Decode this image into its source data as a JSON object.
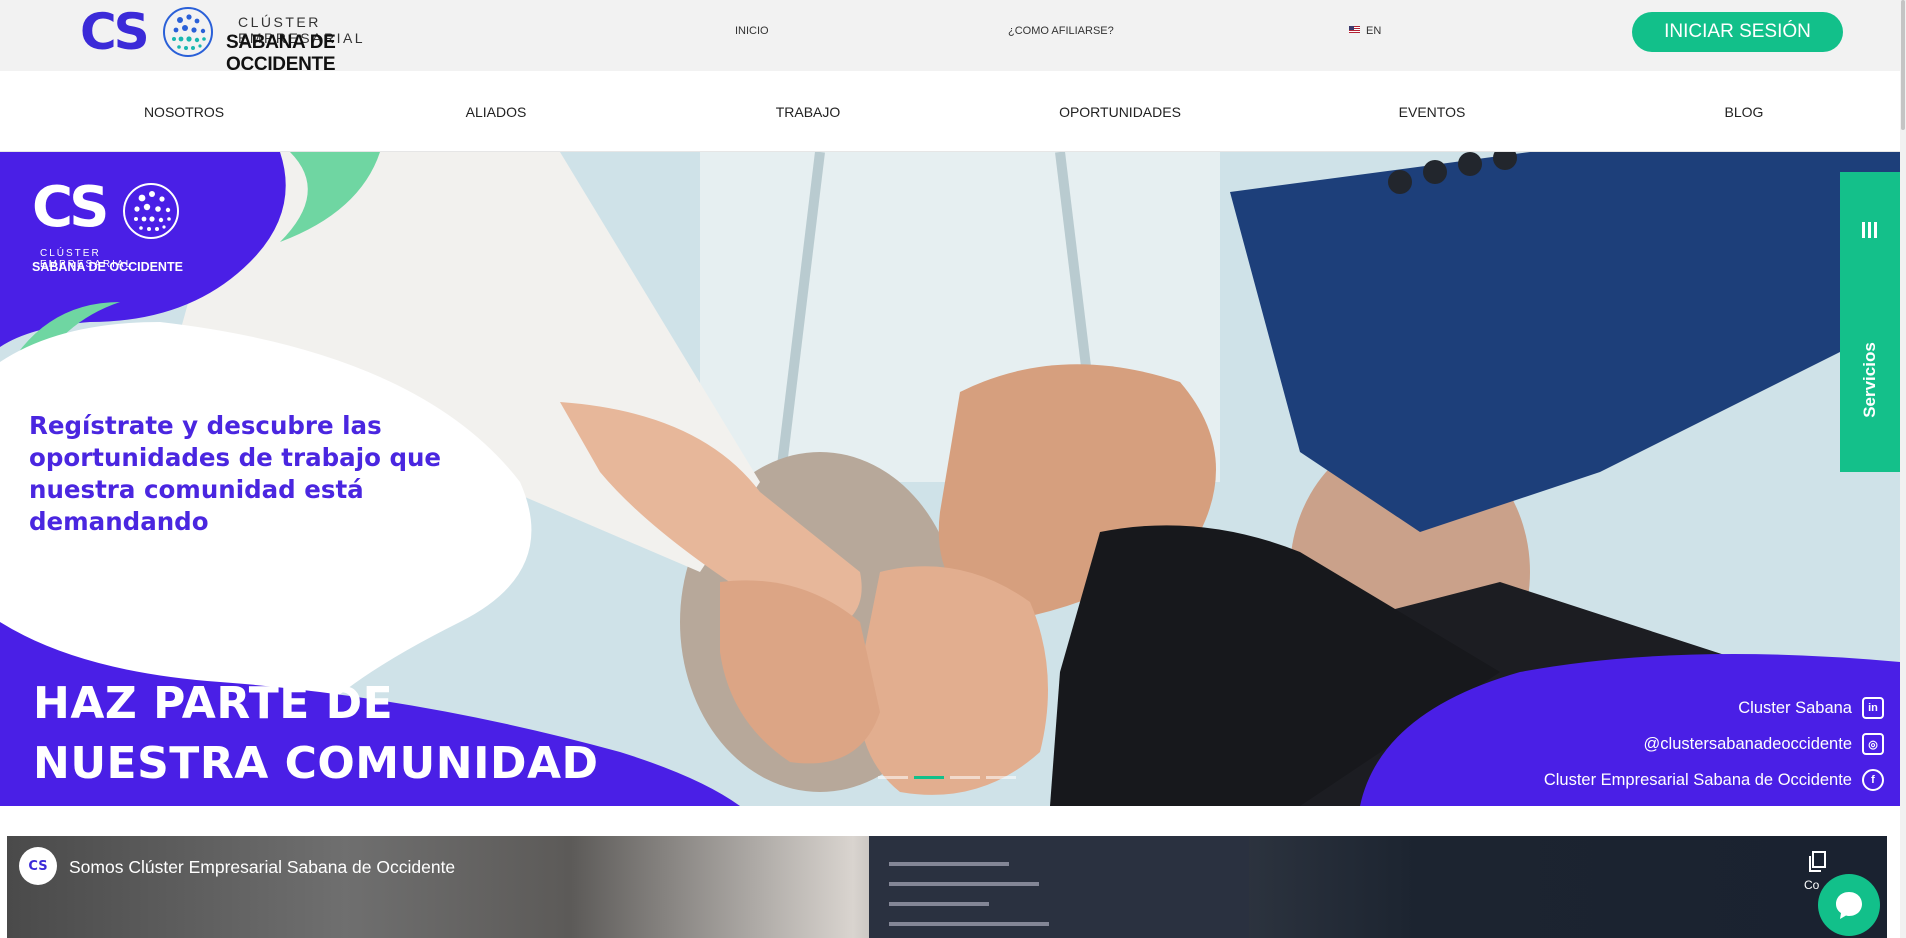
{
  "brand": {
    "logo_letters": "CS",
    "line1": "CLÚSTER EMPRESARIAL",
    "line2": "SABANA DE OCCIDENTE"
  },
  "topbar": {
    "links": [
      "INICIO",
      "¿COMO AFILIARSE?"
    ],
    "language": "EN",
    "login_label": "INICIAR SESIÓN"
  },
  "nav": {
    "items": [
      "NOSOTROS",
      "ALIADOS",
      "TRABAJO",
      "OPORTUNIDADES",
      "EVENTOS",
      "BLOG"
    ]
  },
  "hero": {
    "logo_letters": "CS",
    "logo_line1": "CLÚSTER EMPRESARIAL",
    "logo_line2": "SABANA DE OCCIDENTE",
    "subtitle": "Regístrate y descubre las oportunidades de trabajo que nuestra comunidad está demandando",
    "title_line1": "HAZ PARTE DE",
    "title_line2": "NUESTRA COMUNIDAD",
    "social": [
      {
        "text": "Cluster Sabana",
        "icon": "linkedin-icon"
      },
      {
        "text": "@clustersabanadeoccidente",
        "icon": "instagram-icon"
      },
      {
        "text": "Cluster Empresarial Sabana de Occidente",
        "icon": "facebook-icon"
      }
    ],
    "slides": 4,
    "active_slide": 2
  },
  "sidetab": {
    "label": "Servicios"
  },
  "video": {
    "title": "Somos Clúster Empresarial Sabana de Occidente",
    "avatar_letters": "CS",
    "copy_label": "Co"
  },
  "colors": {
    "brand_purple": "#4a1fe6",
    "brand_green": "#12c08a"
  }
}
